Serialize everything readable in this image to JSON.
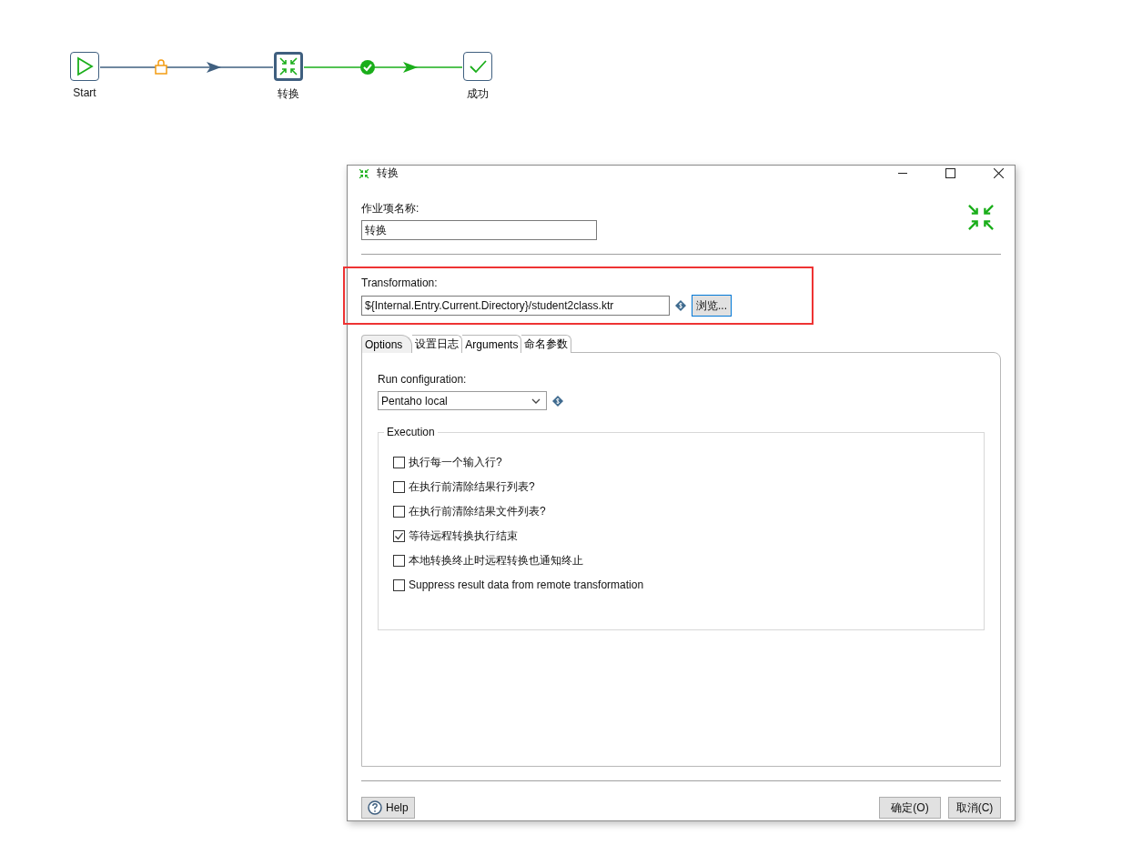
{
  "canvas": {
    "nodes": [
      {
        "kind": "start",
        "label": "Start",
        "selected": false
      },
      {
        "kind": "transformation",
        "label": "转换",
        "selected": true
      },
      {
        "kind": "success",
        "label": "成功",
        "selected": false
      }
    ],
    "hops": [
      {
        "kind": "unconditional"
      },
      {
        "kind": "success"
      }
    ]
  },
  "dialog": {
    "title": "转换",
    "entry_name": {
      "label": "作业项名称:",
      "value": "转换"
    },
    "transformation": {
      "label": "Transformation:",
      "value": "${Internal.Entry.Current.Directory}/student2class.ktr",
      "browse_button": "浏览...",
      "highlighted": true
    },
    "tabs": [
      {
        "label": "Options",
        "selected": true
      },
      {
        "label": "设置日志",
        "selected": false
      },
      {
        "label": "Arguments",
        "selected": false
      },
      {
        "label": "命名参数",
        "selected": false
      }
    ],
    "run_configuration": {
      "label": "Run configuration:",
      "value": "Pentaho local"
    },
    "execution": {
      "title": "Execution",
      "options": [
        {
          "label": "执行每一个输入行?",
          "checked": false
        },
        {
          "label": "在执行前清除结果行列表?",
          "checked": false
        },
        {
          "label": "在执行前清除结果文件列表?",
          "checked": false
        },
        {
          "label": "等待远程转换执行结束",
          "checked": true
        },
        {
          "label": "本地转换终止时远程转换也通知终止",
          "checked": false
        },
        {
          "label": "Suppress result data from remote transformation",
          "checked": false
        }
      ]
    },
    "buttons": {
      "help": "Help",
      "ok": "确定(O)",
      "cancel": "取消(C)"
    }
  }
}
